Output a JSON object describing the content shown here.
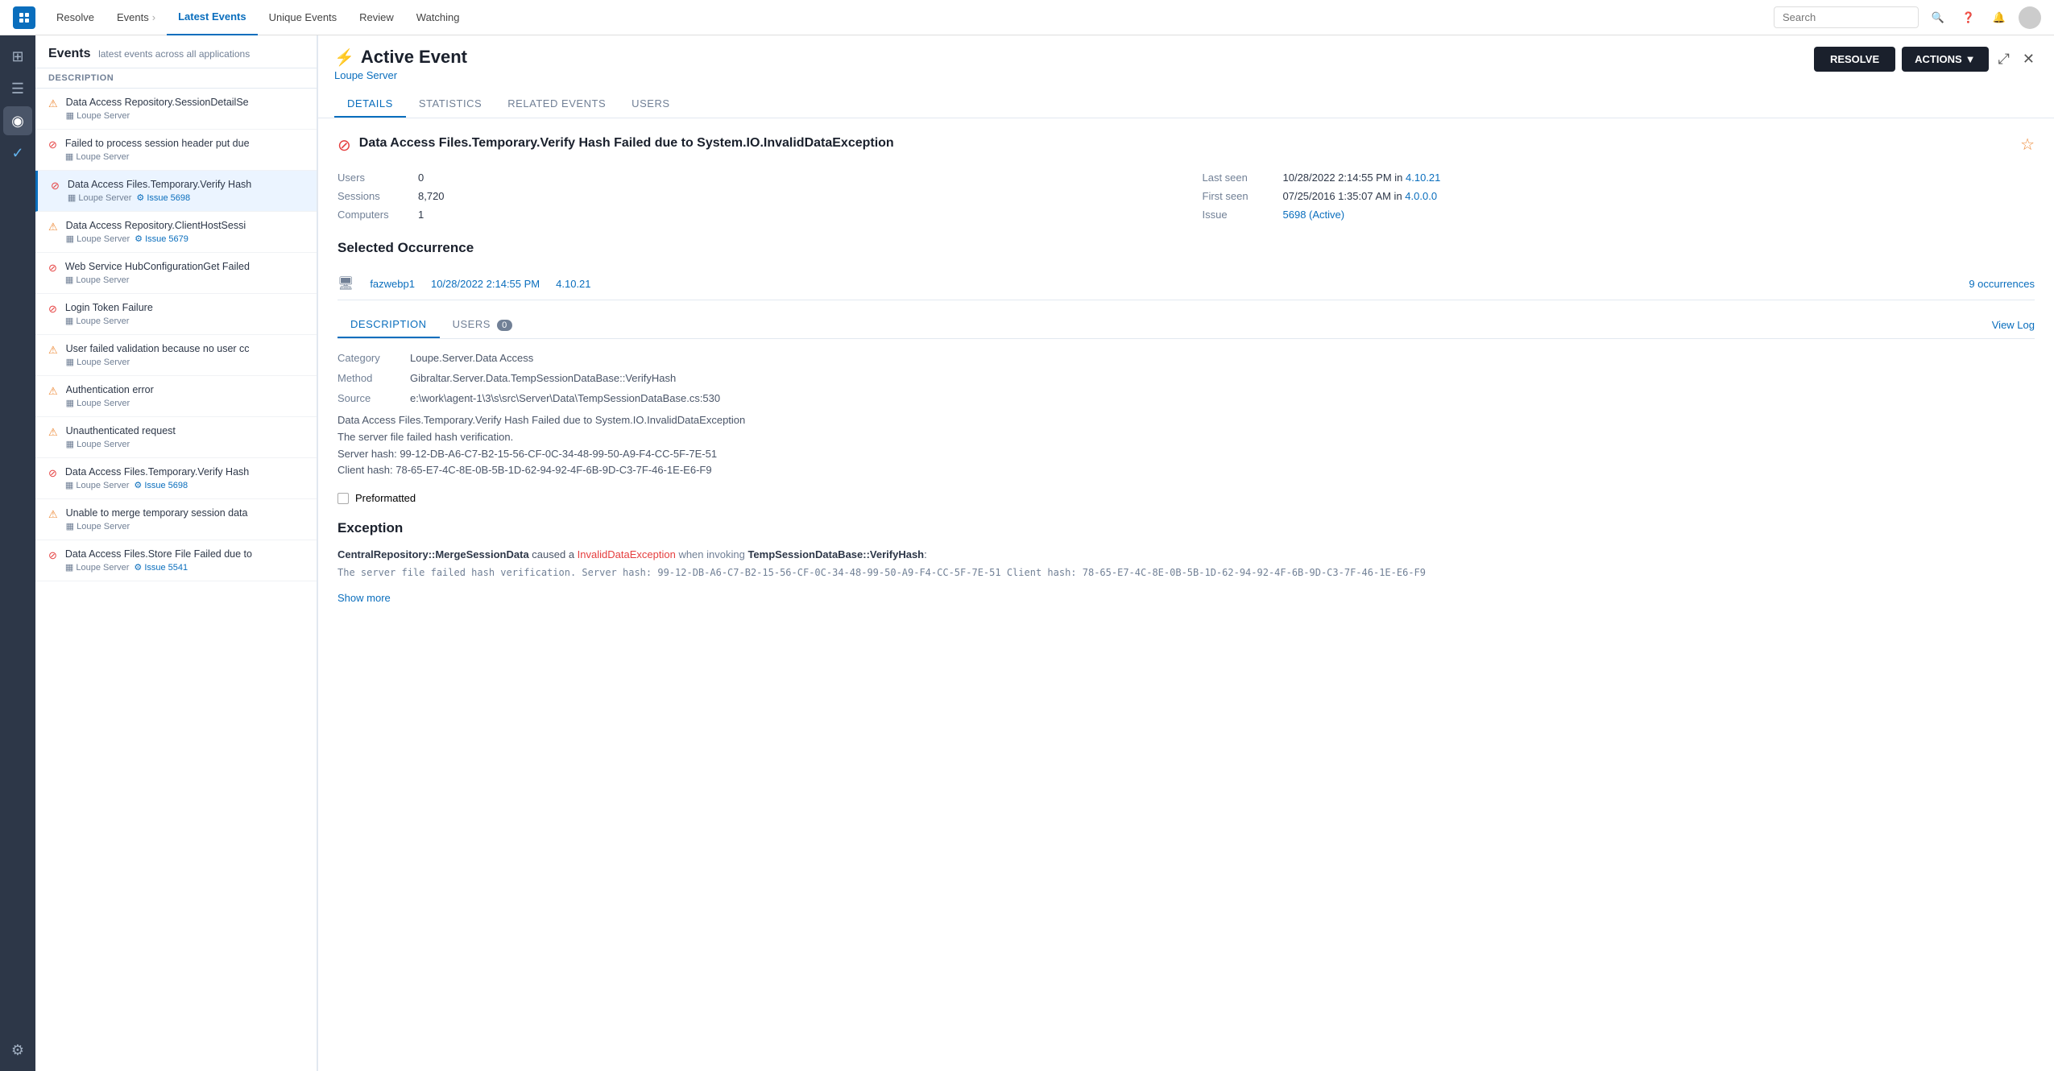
{
  "topnav": {
    "logo_alt": "Resolve",
    "nav_items": [
      {
        "label": "Resolve",
        "active": false
      },
      {
        "label": "Events",
        "active": false
      },
      {
        "label": "Latest Events",
        "active": true
      },
      {
        "label": "Unique Events",
        "active": false
      },
      {
        "label": "Review",
        "active": false
      },
      {
        "label": "Watching",
        "active": false
      }
    ],
    "search_placeholder": "Search"
  },
  "events_panel": {
    "title": "Events",
    "subtitle": "latest events across all applications",
    "col_header": "DESCRIPTION",
    "items": [
      {
        "type": "warning",
        "title": "Data Access Repository.SessionDetailSe",
        "server": "Loupe Server",
        "issue": null,
        "selected": false
      },
      {
        "type": "error",
        "title": "Failed to process session header put due",
        "server": "Loupe Server",
        "issue": null,
        "selected": false
      },
      {
        "type": "error",
        "title": "Data Access Files.Temporary.Verify Hash",
        "server": "Loupe Server",
        "issue": "Issue 5698",
        "selected": true
      },
      {
        "type": "warning",
        "title": "Data Access Repository.ClientHostSessi",
        "server": "Loupe Server",
        "issue": "Issue 5679",
        "selected": false
      },
      {
        "type": "error",
        "title": "Web Service HubConfigurationGet Failed",
        "server": "Loupe Server",
        "issue": null,
        "selected": false
      },
      {
        "type": "error",
        "title": "Login Token Failure",
        "server": "Loupe Server",
        "issue": null,
        "selected": false
      },
      {
        "type": "warning",
        "title": "User failed validation because no user cc",
        "server": "Loupe Server",
        "issue": null,
        "selected": false
      },
      {
        "type": "warning",
        "title": "Authentication error",
        "server": "Loupe Server",
        "issue": null,
        "selected": false
      },
      {
        "type": "warning",
        "title": "Unauthenticated request",
        "server": "Loupe Server",
        "issue": null,
        "selected": false
      },
      {
        "type": "error",
        "title": "Data Access Files.Temporary.Verify Hash",
        "server": "Loupe Server",
        "issue": "Issue 5698",
        "selected": false
      },
      {
        "type": "warning",
        "title": "Unable to merge temporary session data",
        "server": "Loupe Server",
        "issue": null,
        "selected": false
      },
      {
        "type": "error",
        "title": "Data Access Files.Store File Failed due to",
        "server": "Loupe Server",
        "issue": "Issue 5541",
        "selected": false
      }
    ]
  },
  "detail": {
    "panel_title": "Active Event",
    "subtitle": "Loupe Server",
    "btn_resolve": "RESOLVE",
    "btn_actions": "ACTIONS",
    "tabs": [
      "DETAILS",
      "STATISTICS",
      "RELATED EVENTS",
      "USERS"
    ],
    "active_tab": "DETAILS",
    "event_title": "Data Access Files.Temporary.Verify Hash Failed due to System.IO.InvalidDataException",
    "stats": {
      "users_label": "Users",
      "users_val": "0",
      "sessions_label": "Sessions",
      "sessions_val": "8,720",
      "computers_label": "Computers",
      "computers_val": "1",
      "last_seen_label": "Last seen",
      "last_seen_val": "10/28/2022 2:14:55 PM in ",
      "last_seen_ver": "4.10.21",
      "first_seen_label": "First seen",
      "first_seen_val": "07/25/2016 1:35:07 AM in ",
      "first_seen_ver": "4.0.0.0",
      "issue_label": "Issue",
      "issue_val": "5698 (Active)"
    },
    "selected_occurrence": {
      "title": "Selected Occurrence",
      "host": "fazwebp1",
      "date": "10/28/2022 2:14:55 PM",
      "version": "4.10.21",
      "occurrences": "9 occurrences"
    },
    "sub_tabs": [
      "DESCRIPTION",
      "USERS"
    ],
    "users_badge": "0",
    "active_sub_tab": "DESCRIPTION",
    "view_log": "View Log",
    "fields": {
      "category_label": "Category",
      "category_val": "Loupe.Server.Data Access",
      "method_label": "Method",
      "method_val": "Gibraltar.Server.Data.TempSessionDataBase::VerifyHash",
      "source_label": "Source",
      "source_val": "e:\\work\\agent-1\\3\\s\\src\\Server\\Data\\TempSessionDataBase.cs:530"
    },
    "description_text": [
      "Data Access Files.Temporary.Verify Hash Failed due to System.IO.InvalidDataException",
      "The server file failed hash verification.",
      "Server hash: 99-12-DB-A6-C7-B2-15-56-CF-0C-34-48-99-50-A9-F4-CC-5F-7E-51",
      "Client hash: 78-65-E7-4C-8E-0B-5B-1D-62-94-92-4F-6B-9D-C3-7F-46-1E-E6-F9"
    ],
    "preformatted_label": "Preformatted",
    "exception": {
      "title": "Exception",
      "body_bold1": "CentralRepository::MergeSessionData",
      "body_caused": " caused a ",
      "body_red": "InvalidDataException",
      "body_when": " when invoking ",
      "body_bold2": "TempSessionDataBase::VerifyHash",
      "body_colon": ":",
      "body_detail": "The server file failed hash verification. Server hash: 99-12-DB-A6-C7-B2-15-56-CF-0C-34-48-99-50-A9-F4-CC-5F-7E-51 Client hash: 78-65-E7-4C-8E-0B-5B-1D-62-94-92-4F-6B-9D-C3-7F-46-1E-E6-F9",
      "show_more": "Show more"
    }
  },
  "icons": {
    "home": "⊞",
    "events": "☰",
    "monitor": "◉",
    "check": "✓",
    "settings": "⚙"
  }
}
